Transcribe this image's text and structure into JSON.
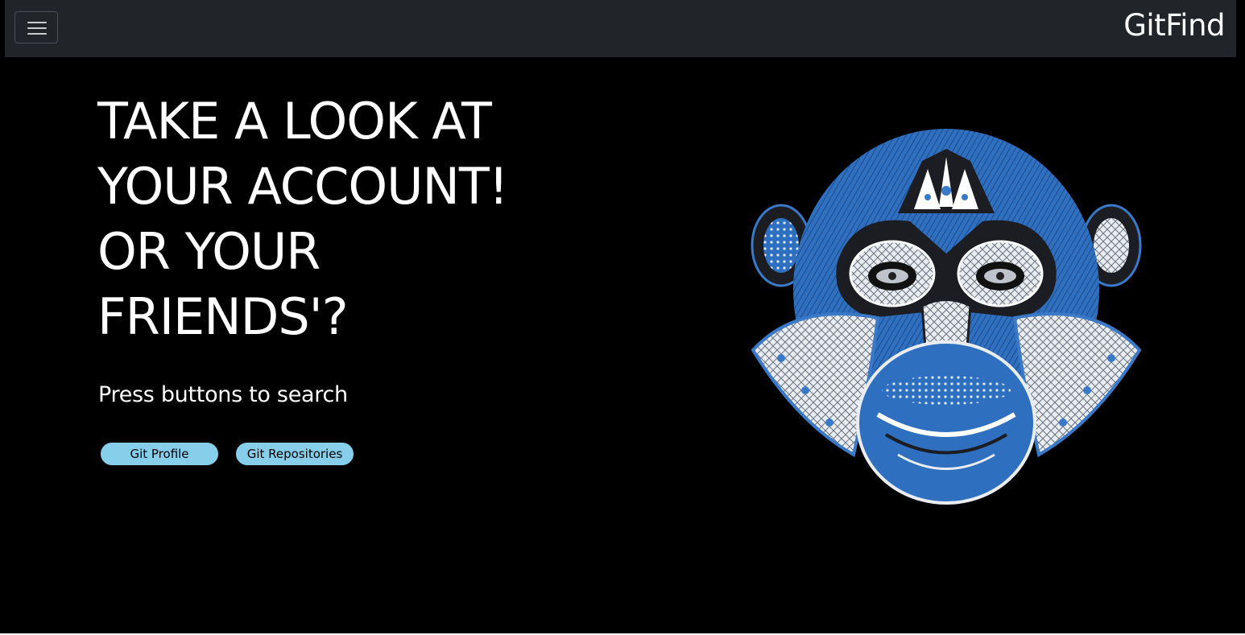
{
  "navbar": {
    "brand": "GitFind",
    "toggler_icon": "hamburger-menu-icon"
  },
  "hero": {
    "title_lines": [
      "TAKE A LOOK AT",
      "YOUR ACCOUNT!",
      "OR YOUR",
      "FRIENDS'?"
    ],
    "subtitle": "Press buttons to search",
    "buttons": {
      "profile_label": "Git Profile",
      "repositories_label": "Git Repositories"
    },
    "illustration": "monkey-head-illustration"
  },
  "colors": {
    "background": "#000000",
    "navbar": "#212529",
    "button": "#87ceeb",
    "accent_blue": "#3a78c8"
  }
}
